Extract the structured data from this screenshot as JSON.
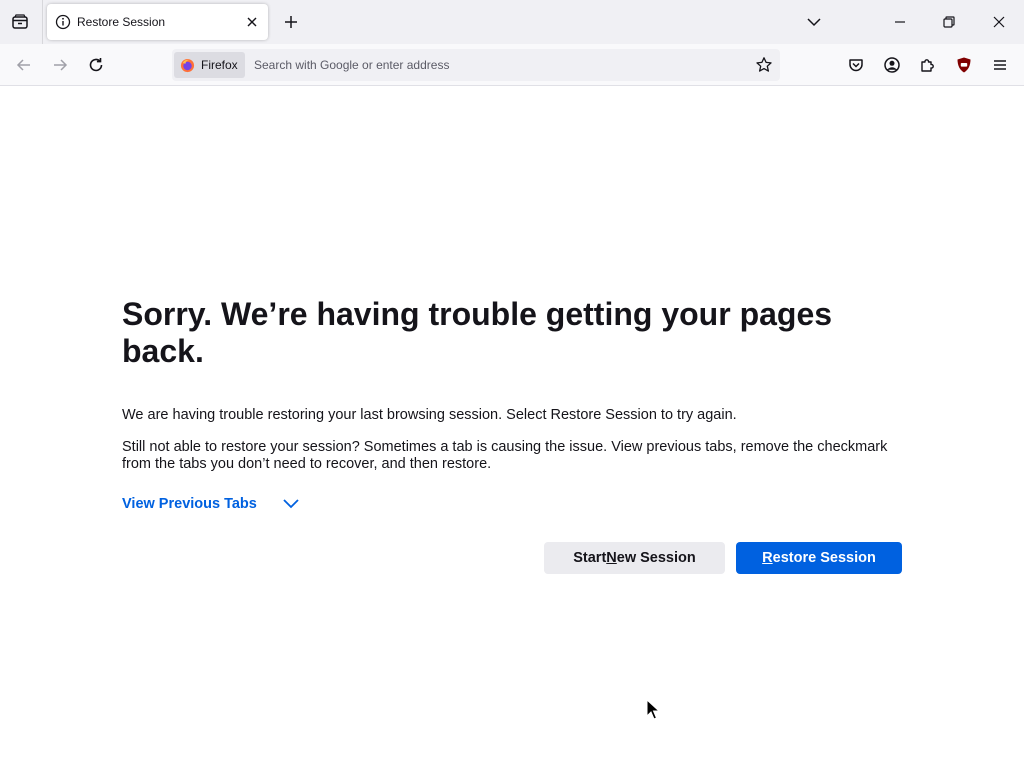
{
  "tab": {
    "title": "Restore Session"
  },
  "urlbar": {
    "identity_label": "Firefox",
    "placeholder": "Search with Google or enter address",
    "value": ""
  },
  "page": {
    "heading": "Sorry. We’re having trouble getting your pages back.",
    "paragraph_1": "We are having trouble restoring your last browsing session. Select Restore Session to try again.",
    "paragraph_2": "Still not able to restore your session? Sometimes a tab is causing the issue. View previous tabs, remove the checkmark from the tabs you don’t need to recover, and then restore.",
    "view_previous_tabs": "View Previous Tabs",
    "start_button": {
      "before": "Start ",
      "accesskey": "N",
      "after": "ew Session"
    },
    "restore_button": {
      "before": "",
      "accesskey": "R",
      "after": "estore Session"
    }
  },
  "colors": {
    "accent": "#0061e0",
    "ublock": "#800000",
    "text": "#15141a",
    "tabstrip_bg": "#f0f0f4"
  },
  "icons": {
    "tab_overview": "tab-overview-icon",
    "tab_info": "info-icon",
    "tab_close": "close-icon",
    "new_tab": "plus-icon",
    "tab_list": "chevron-down-icon",
    "back": "arrow-left-icon",
    "forward": "arrow-right-icon",
    "reload": "reload-icon",
    "bookmark": "star-icon",
    "pocket": "pocket-icon",
    "account": "account-icon",
    "extensions": "puzzle-icon",
    "ublock": "ublock-origin-icon",
    "menu": "hamburger-menu-icon"
  }
}
